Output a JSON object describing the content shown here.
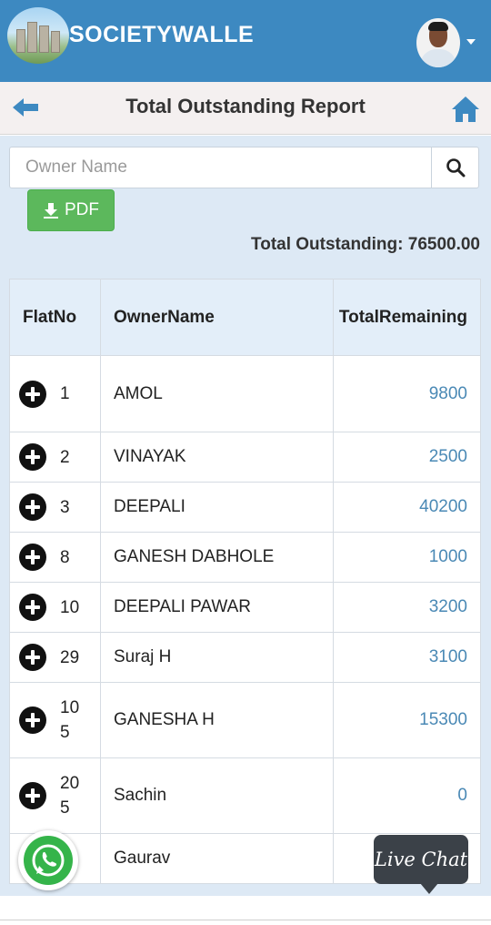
{
  "app": {
    "brand": "SOCIETYWALLE"
  },
  "header": {
    "title": "Total Outstanding Report"
  },
  "search": {
    "placeholder": "Owner Name"
  },
  "pdf_button": {
    "label": "PDF"
  },
  "summary": {
    "total_outstanding": "Total Outstanding: 76500.00"
  },
  "table": {
    "columns": [
      "FlatNo",
      "OwnerName",
      "TotalRemaining"
    ],
    "rows": [
      {
        "flat": "1",
        "owner": "AMOL",
        "amount": "9800"
      },
      {
        "flat": "2",
        "owner": "VINAYAK",
        "amount": "2500"
      },
      {
        "flat": "3",
        "owner": "DEEPALI",
        "amount": "40200"
      },
      {
        "flat": "8",
        "owner": "GANESH DABHOLE",
        "amount": "1000"
      },
      {
        "flat": "10",
        "owner": "DEEPALI PAWAR",
        "amount": "3200"
      },
      {
        "flat": "29",
        "owner": "Suraj H",
        "amount": "3100"
      },
      {
        "flat": "105",
        "owner": "GANESHA H",
        "amount": "15300"
      },
      {
        "flat": "205",
        "owner": "Sachin",
        "amount": "0"
      },
      {
        "flat": "",
        "owner": "Gaurav",
        "amount": ""
      }
    ]
  },
  "live_chat": {
    "label": "Live Chat"
  },
  "colors": {
    "header": "#3d89c1",
    "panel": "#dde9f5",
    "pdf": "#5cb85c",
    "amount": "#4a89b5"
  },
  "icons": {
    "back": "arrow-left-icon",
    "home": "home-icon",
    "search": "search-icon",
    "download": "download-icon",
    "expand": "plus-circle-icon",
    "whatsapp": "whatsapp-icon"
  }
}
